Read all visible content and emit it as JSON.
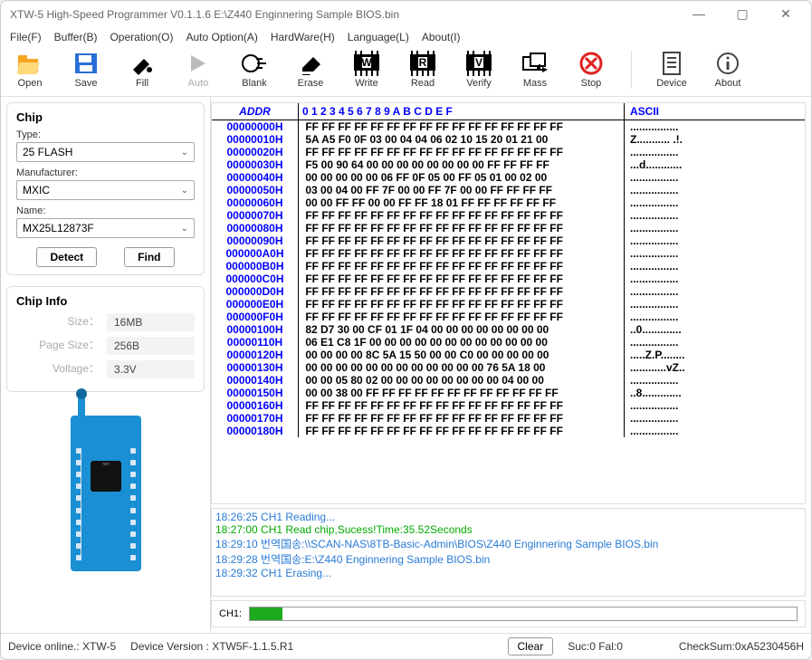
{
  "title": "XTW-5 High-Speed Programmer  V0.1.1.6    E:\\Z440 Enginnering Sample BIOS.bin",
  "menu": [
    "File(F)",
    "Buffer(B)",
    "Operation(O)",
    "Auto Option(A)",
    "HardWare(H)",
    "Language(L)",
    "About(I)"
  ],
  "toolbar": [
    {
      "name": "open",
      "label": "Open",
      "color": "#f5a623"
    },
    {
      "name": "save",
      "label": "Save",
      "color": "#2a6fd6"
    },
    {
      "name": "fill",
      "label": "Fill",
      "color": "#000"
    },
    {
      "name": "auto",
      "label": "Auto",
      "disabled": true
    },
    {
      "name": "blank",
      "label": "Blank",
      "color": "#000"
    },
    {
      "name": "erase",
      "label": "Erase",
      "color": "#000"
    },
    {
      "name": "write",
      "label": "Write",
      "color": "#000"
    },
    {
      "name": "read",
      "label": "Read",
      "color": "#000"
    },
    {
      "name": "verify",
      "label": "Verify",
      "color": "#000"
    },
    {
      "name": "mass",
      "label": "Mass",
      "color": "#000"
    },
    {
      "name": "stop",
      "label": "Stop",
      "color": "#e02020"
    },
    {
      "name": "device",
      "label": "Device",
      "color": "#444"
    },
    {
      "name": "about",
      "label": "About",
      "color": "#444"
    }
  ],
  "chip": {
    "heading": "Chip",
    "type_label": "Type:",
    "type": "25 FLASH",
    "mfr_label": "Manufacturer:",
    "mfr": "MXIC",
    "name_label": "Name:",
    "name": "MX25L12873F",
    "detect": "Detect",
    "find": "Find"
  },
  "chip_info": {
    "heading": "Chip Info",
    "rows": [
      {
        "k": "Size：",
        "v": "16MB"
      },
      {
        "k": "Page Size：",
        "v": "256B"
      },
      {
        "k": "Voltage：",
        "v": "3.3V"
      }
    ]
  },
  "hex": {
    "addr_header": "ADDR",
    "cols": "0  1  2  3  4  5  6  7  8  9  A  B  C  D  E  F",
    "ascii_header": "ASCII",
    "rows": [
      {
        "a": "00000000H",
        "b": "FF FF FF FF FF FF FF FF FF FF FF FF FF FF FF FF",
        "s": "................"
      },
      {
        "a": "00000010H",
        "b": "5A A5 F0 0F 03 00 04 04 06 02 10 15 20 01 21 00",
        "s": "Z........... .!."
      },
      {
        "a": "00000020H",
        "b": "FF FF FF FF FF FF FF FF FF FF FF FF FF FF FF FF",
        "s": "................"
      },
      {
        "a": "00000030H",
        "b": "F5 00 90 64 00 00 00 00 00 00 00 00 FF FF FF FF",
        "s": "...d............"
      },
      {
        "a": "00000040H",
        "b": "00 00 00 00 00 06 FF 0F 05 00 FF 05 01 00 02 00",
        "s": "................"
      },
      {
        "a": "00000050H",
        "b": "03 00 04 00 FF 7F 00 00 FF 7F 00 00 FF FF FF FF",
        "s": "................"
      },
      {
        "a": "00000060H",
        "b": "00 00 FF FF 00 00 FF FF 18 01 FF FF FF FF FF FF",
        "s": "................"
      },
      {
        "a": "00000070H",
        "b": "FF FF FF FF FF FF FF FF FF FF FF FF FF FF FF FF",
        "s": "................"
      },
      {
        "a": "00000080H",
        "b": "FF FF FF FF FF FF FF FF FF FF FF FF FF FF FF FF",
        "s": "................"
      },
      {
        "a": "00000090H",
        "b": "FF FF FF FF FF FF FF FF FF FF FF FF FF FF FF FF",
        "s": "................"
      },
      {
        "a": "000000A0H",
        "b": "FF FF FF FF FF FF FF FF FF FF FF FF FF FF FF FF",
        "s": "................"
      },
      {
        "a": "000000B0H",
        "b": "FF FF FF FF FF FF FF FF FF FF FF FF FF FF FF FF",
        "s": "................"
      },
      {
        "a": "000000C0H",
        "b": "FF FF FF FF FF FF FF FF FF FF FF FF FF FF FF FF",
        "s": "................"
      },
      {
        "a": "000000D0H",
        "b": "FF FF FF FF FF FF FF FF FF FF FF FF FF FF FF FF",
        "s": "................"
      },
      {
        "a": "000000E0H",
        "b": "FF FF FF FF FF FF FF FF FF FF FF FF FF FF FF FF",
        "s": "................"
      },
      {
        "a": "000000F0H",
        "b": "FF FF FF FF FF FF FF FF FF FF FF FF FF FF FF FF",
        "s": "................"
      },
      {
        "a": "00000100H",
        "b": "82 D7 30 00 CF 01 1F 04 00 00 00 00 00 00 00 00",
        "s": "..0............."
      },
      {
        "a": "00000110H",
        "b": "06 E1 C8 1F 00 00 00 00 00 00 00 00 00 00 00 00",
        "s": "................"
      },
      {
        "a": "00000120H",
        "b": "00 00 00 00 8C 5A 15 50 00 00 C0 00 00 00 00 00",
        "s": ".....Z.P........"
      },
      {
        "a": "00000130H",
        "b": "00 00 00 00 00 00 00 00 00 00 00 00 76 5A 18 00",
        "s": "............vZ.."
      },
      {
        "a": "00000140H",
        "b": "00 00 05 80 02 00 00 00 00 00 00 00 00 04 00 00",
        "s": "................"
      },
      {
        "a": "00000150H",
        "b": "00 00 38 00 FF FF FF FF FF FF FF FF FF FF FF FF",
        "s": "..8............."
      },
      {
        "a": "00000160H",
        "b": "FF FF FF FF FF FF FF FF FF FF FF FF FF FF FF FF",
        "s": "................"
      },
      {
        "a": "00000170H",
        "b": "FF FF FF FF FF FF FF FF FF FF FF FF FF FF FF FF",
        "s": "................"
      },
      {
        "a": "00000180H",
        "b": "FF FF FF FF FF FF FF FF FF FF FF FF FF FF FF FF",
        "s": "................"
      }
    ]
  },
  "log": [
    {
      "c": "blue",
      "t": "18:26:25 CH1 Reading..."
    },
    {
      "c": "green",
      "t": "18:27:00 CH1 Read chip,Sucess!Time:35.52Seconds"
    },
    {
      "c": "blue",
      "t": "18:29:10 번역国송:\\\\SCAN-NAS\\8TB-Basic-Admin\\BIOS\\Z440 Enginnering Sample BIOS.bin"
    },
    {
      "c": "blue",
      "t": "18:29:28 번역国송:E:\\Z440 Enginnering Sample BIOS.bin"
    },
    {
      "c": "blue",
      "t": "18:29:32 CH1 Erasing..."
    }
  ],
  "progress": {
    "ch": "CH1:",
    "pct": 6
  },
  "status": {
    "online": "Device online.: XTW-5",
    "version": "Device Version : XTW5F-1.1.5.R1",
    "clear": "Clear",
    "sucfail": "Suc:0  Fal:0",
    "checksum": "CheckSum:0xA5230456H"
  }
}
